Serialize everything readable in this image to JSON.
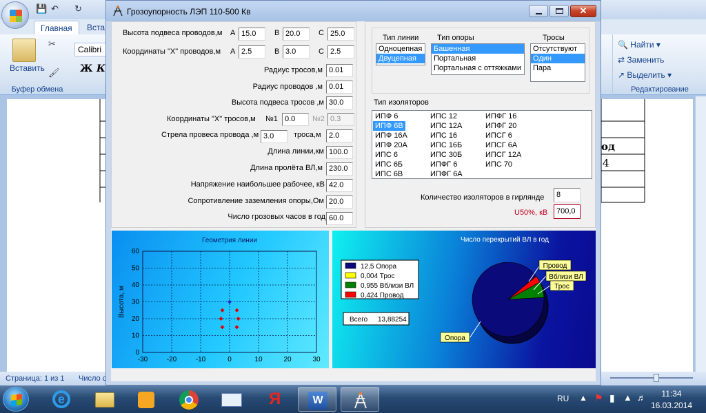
{
  "word": {
    "tabs": [
      "Главная",
      "Вста"
    ],
    "clipboard": {
      "paste_label": "Вставить",
      "group_label": "Буфер обмена"
    },
    "font": {
      "name": "Calibri",
      "bold": "Ж",
      "italic": "К"
    },
    "editing": {
      "find": "Найти",
      "replace": "Заменить",
      "select": "Выделить",
      "group_label": "Редактирование"
    },
    "doc_fragment": [
      "од",
      "4"
    ],
    "status": {
      "page": "Страница: 1 из 1",
      "words": "Число с"
    }
  },
  "taskbar": {
    "lang": "RU",
    "time": "11:34",
    "date": "16.03.2014"
  },
  "app": {
    "title": "Грозоупорность ЛЭП 110-500 Кв",
    "params": {
      "wire_height": {
        "label": "Высота подвеса проводов,м",
        "a_label": "A",
        "a": "15.0",
        "b_label": "B",
        "b": "20.0",
        "c_label": "C",
        "c": "25.0"
      },
      "wire_x": {
        "label": "Координаты \"X\" проводов,м",
        "a_label": "A",
        "a": "2.5",
        "b_label": "B",
        "b": "3.0",
        "c_label": "C",
        "c": "2.5"
      },
      "cable_radius": {
        "label": "Радиус тросов,м",
        "value": "0.01"
      },
      "wire_radius": {
        "label": "Радиус  проводов ,м",
        "value": "0.01"
      },
      "cable_height": {
        "label": "Высота  подвеса тросов ,м",
        "value": "30.0"
      },
      "cable_x": {
        "label": "Координаты \"X\" тросов,м",
        "n1_label": "№1",
        "n1": "0.0",
        "n2_label": "№2",
        "n2": "0.3"
      },
      "sag": {
        "label": "Стрела провеса провода ,м",
        "wire": "3.0",
        "cable_label": "троса,м",
        "cable": "2.0"
      },
      "line_length": {
        "label": "Длина  линии,км",
        "value": "100.0"
      },
      "span_length": {
        "label": "Длина пролёта ВЛ,м",
        "value": "230.0"
      },
      "voltage": {
        "label": "Напряжение наибольшее рабочее, кВ",
        "value": "42.0"
      },
      "grounding": {
        "label": "Сопротивление заземления опоры,Ом",
        "value": "20.0"
      },
      "storm_hours": {
        "label": "Число грозовых часов в год",
        "value": "60.0"
      }
    },
    "line_type": {
      "label": "Тип линии",
      "options": [
        "Одноцепная",
        "Двуцепная"
      ],
      "selected": 1
    },
    "tower_type": {
      "label": "Тип опоры",
      "options": [
        "Башенная",
        "Портальная",
        "Портальная с оттяжками"
      ],
      "selected": 0
    },
    "cables": {
      "label": "Тросы",
      "options": [
        "Отсутствуют",
        "Один",
        "Пара"
      ],
      "selected": 1
    },
    "insulator_type": {
      "label": "Тип  изоляторов",
      "columns": [
        [
          "ИПФ 6",
          "ИПФ 6В",
          "ИПФ 16А",
          "ИПФ 20А",
          "ИПС 6",
          "ИПС 6Б",
          "ИПС 6В"
        ],
        [
          "ИПС 12",
          "ИПС 12А",
          "ИПС 16",
          "ИПС 16Б",
          "ИПС 30Б",
          "ИПФГ 6",
          "ИПФГ 6А"
        ],
        [
          "ИПФГ 16",
          "ИПФГ 20",
          "ИПСГ 6",
          "ИПСГ 6А",
          "ИПСГ 12А",
          "ИПС 70"
        ]
      ],
      "selected": "ИПФ 6В"
    },
    "insulator_count": {
      "label": "Количество изоляторов в гирлянде",
      "value": "8"
    },
    "u50": {
      "label": "U50%, кВ",
      "value": "700,0"
    }
  },
  "chart_data": [
    {
      "type": "scatter",
      "title": "Геометрия линии",
      "xlabel": "",
      "ylabel": "Высота, м",
      "xlim": [
        -30,
        30
      ],
      "ylim": [
        0,
        60
      ],
      "xticks": [
        -30,
        -20,
        -10,
        0,
        10,
        20,
        30
      ],
      "yticks": [
        0,
        10,
        20,
        30,
        40,
        50,
        60
      ],
      "grid": true,
      "series": [
        {
          "color": "#2a2ad0",
          "points": [
            [
              0,
              30
            ]
          ]
        },
        {
          "color": "#e00000",
          "points": [
            [
              -2.5,
              25
            ],
            [
              2.5,
              25
            ],
            [
              -3,
              20
            ],
            [
              3,
              20
            ],
            [
              -2.5,
              15
            ],
            [
              2.5,
              15
            ]
          ]
        }
      ]
    },
    {
      "type": "pie",
      "title": "Число перекрытий ВЛ в год",
      "total_label": "Всего",
      "total": "13,88254",
      "slices": [
        {
          "legend": "12,5 Опора",
          "label": "Опора",
          "value": 12.5,
          "color": "#0a0a7a"
        },
        {
          "legend": "0,004 Трос",
          "label": "Трос",
          "value": 0.004,
          "color": "#ffff00"
        },
        {
          "legend": "0,955 Вблизи ВЛ",
          "label": "Вблизи ВЛ",
          "value": 0.955,
          "color": "#008000"
        },
        {
          "legend": "0,424 Провод",
          "label": "Провод",
          "value": 0.424,
          "color": "#ff0000"
        }
      ],
      "legend_position": "left"
    }
  ]
}
